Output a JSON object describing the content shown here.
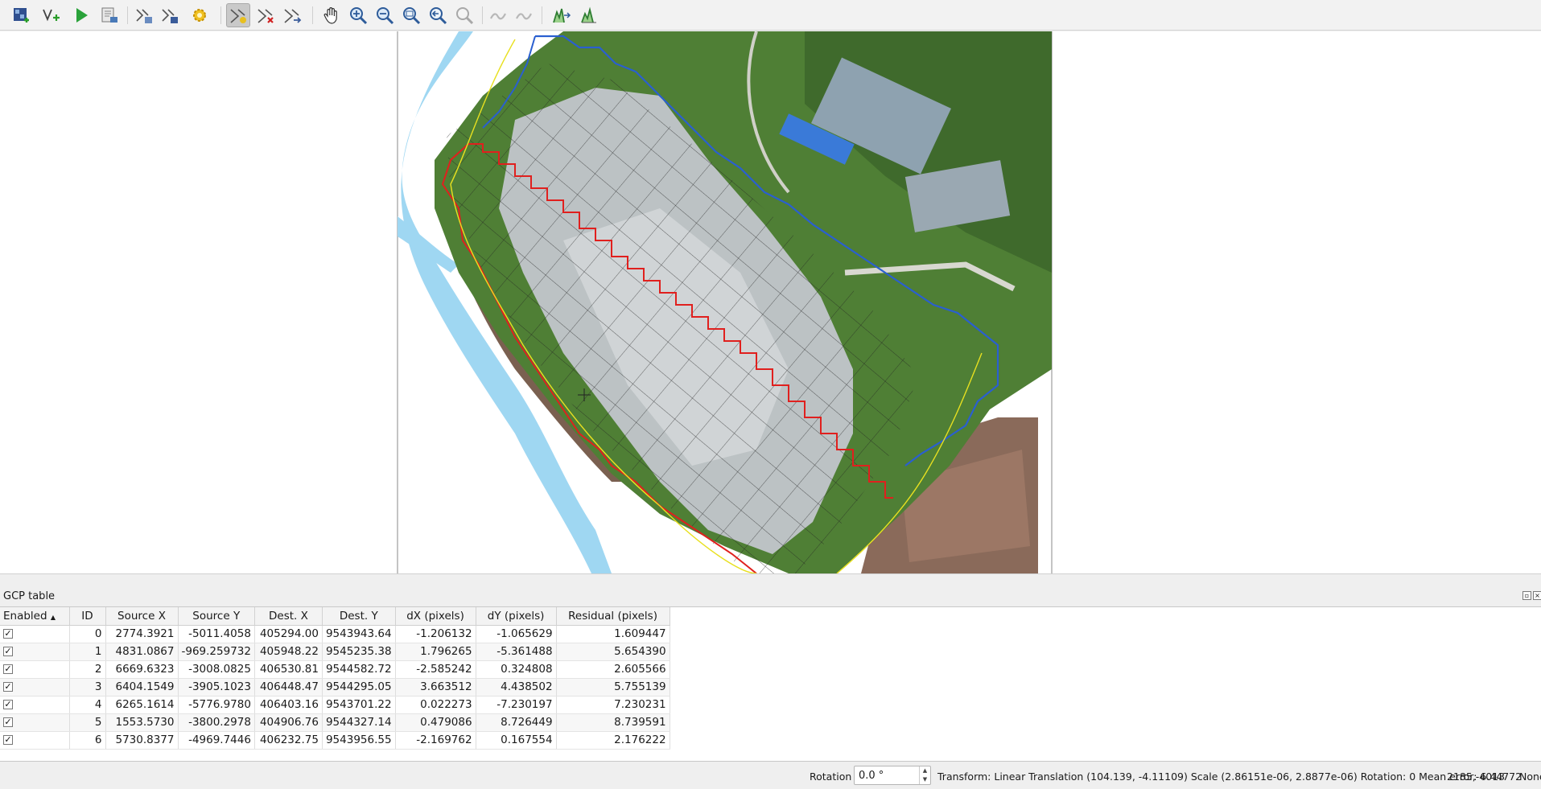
{
  "toolbar": {
    "buttons": [
      {
        "name": "open-raster-icon"
      },
      {
        "name": "start-georeferencing-icon"
      },
      {
        "name": "generate-gdal-script-icon"
      },
      {
        "name": "load-gcp-points-icon"
      },
      {
        "name": "save-gcp-points-icon"
      },
      {
        "name": "transformation-settings-icon"
      },
      {
        "name": "add-point-icon"
      },
      {
        "name": "delete-point-icon"
      },
      {
        "name": "move-gcp-point-icon"
      },
      {
        "name": "pan-icon"
      },
      {
        "name": "zoom-in-icon"
      },
      {
        "name": "zoom-out-icon"
      },
      {
        "name": "zoom-to-layer-icon"
      },
      {
        "name": "zoom-last-icon"
      },
      {
        "name": "zoom-next-icon"
      },
      {
        "name": "link-georeferencer-to-qgis-icon"
      },
      {
        "name": "link-qgis-to-georeferencer-icon"
      },
      {
        "name": "full-histogram-stretch-icon"
      },
      {
        "name": "local-histogram-stretch-icon"
      }
    ]
  },
  "gcp_panel": {
    "title": "GCP table",
    "columns": [
      "Enabled",
      "ID",
      "Source X",
      "Source Y",
      "Dest. X",
      "Dest. Y",
      "dX (pixels)",
      "dY (pixels)",
      "Residual (pixels)"
    ],
    "sort_indicator": "▲",
    "rows": [
      {
        "enabled": "✓",
        "id": "0",
        "source_x": "2774.3921",
        "source_y": "-5011.4058",
        "dest_x": "405294.00",
        "dest_y": "9543943.64",
        "dx": "-1.206132",
        "dy": "-1.065629",
        "residual": "1.609447"
      },
      {
        "enabled": "✓",
        "id": "1",
        "source_x": "4831.0867",
        "source_y": "-969.259732",
        "dest_x": "405948.22",
        "dest_y": "9545235.38",
        "dx": "1.796265",
        "dy": "-5.361488",
        "residual": "5.654390"
      },
      {
        "enabled": "✓",
        "id": "2",
        "source_x": "6669.6323",
        "source_y": "-3008.0825",
        "dest_x": "406530.81",
        "dest_y": "9544582.72",
        "dx": "-2.585242",
        "dy": "0.324808",
        "residual": "2.605566"
      },
      {
        "enabled": "✓",
        "id": "3",
        "source_x": "6404.1549",
        "source_y": "-3905.1023",
        "dest_x": "406448.47",
        "dest_y": "9544295.05",
        "dx": "3.663512",
        "dy": "4.438502",
        "residual": "5.755139"
      },
      {
        "enabled": "✓",
        "id": "4",
        "source_x": "6265.1614",
        "source_y": "-5776.9780",
        "dest_x": "406403.16",
        "dest_y": "9543701.22",
        "dx": "0.022273",
        "dy": "-7.230197",
        "residual": "7.230231"
      },
      {
        "enabled": "✓",
        "id": "5",
        "source_x": "1553.5730",
        "source_y": "-3800.2978",
        "dest_x": "404906.76",
        "dest_y": "9544327.14",
        "dx": "0.479086",
        "dy": "8.726449",
        "residual": "8.739591"
      },
      {
        "enabled": "✓",
        "id": "6",
        "source_x": "5730.8377",
        "source_y": "-4969.7446",
        "dest_x": "406232.75",
        "dest_y": "9543956.55",
        "dx": "-2.169762",
        "dy": "0.167554",
        "residual": "2.176222"
      }
    ]
  },
  "statusbar": {
    "rotation_label": "Rotation",
    "rotation_value": "0.0 °",
    "transform_text": "Transform: Linear Translation (104.139, -4.11109) Scale (2.86151e-06, 2.8877e-06) Rotation: 0 Mean error: 6.44772",
    "coordinates": "2185,-4013",
    "crs": "None"
  },
  "colors": {
    "boundary_red": "#e0201e",
    "boundary_blue": "#2a5fd0",
    "river_blue": "#9fd7f2",
    "buffer_yellow": "#e8e020"
  }
}
